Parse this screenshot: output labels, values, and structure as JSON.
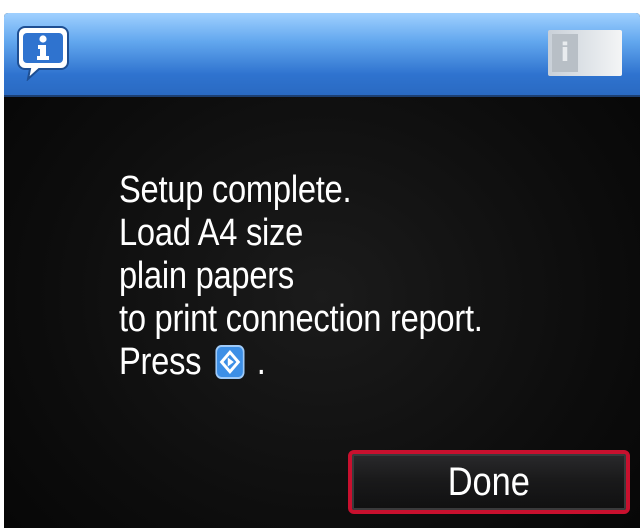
{
  "header": {
    "info_icon": "info-speech-bubble-icon",
    "status_icon": "network-status-icon"
  },
  "message": {
    "lines": [
      "Setup complete.",
      "Load A4 size",
      "plain papers",
      "to print connection report."
    ],
    "press_prefix": "Press",
    "press_suffix": ".",
    "press_icon": "start-button-icon"
  },
  "done_button": {
    "label": "Done"
  },
  "colors": {
    "header_blue": "#3a7fd9",
    "background": "#111111",
    "text": "#ffffff",
    "highlight_red": "#c8102e",
    "start_icon_blue": "#3d8fe6"
  }
}
